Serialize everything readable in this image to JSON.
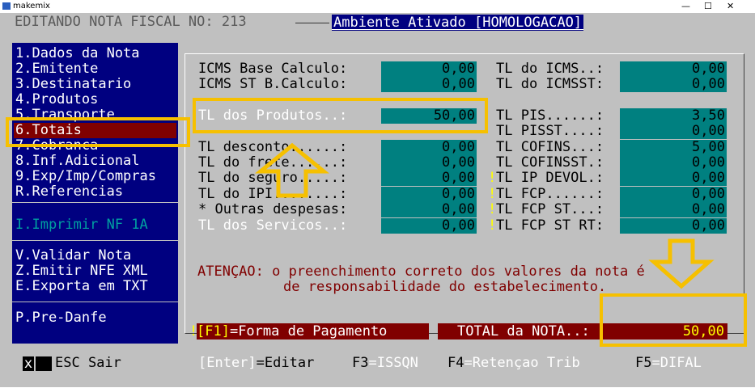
{
  "window": {
    "title": "makemix",
    "minimize": "—",
    "maximize": "☐",
    "close": "✕"
  },
  "header": {
    "title": "EDITANDO NOTA FISCAL NO: 213",
    "ambiente": "Ambiente Ativado [HOMOLOGACAO]"
  },
  "menu": {
    "items": [
      "1.Dados da Nota",
      "2.Emitente",
      "3.Destinatario",
      "4.Produtos",
      "5.Transporte",
      "6.Totais",
      "7.Cobranca",
      "8.Inf.Adicional",
      "9.Exp/Imp/Compras",
      "R.Referencias"
    ],
    "imprimir": "I.Imprimir NF 1A",
    "actions": [
      "V.Validar Nota",
      "Z.Emitir NFE XML",
      "E.Exporta em TXT"
    ],
    "predanfe": "P.Pre-Danfe"
  },
  "left_fields": [
    {
      "label": "ICMS Base Calculo:",
      "value": "0,00"
    },
    {
      "label": "ICMS ST B.Calculo:",
      "value": "0,00"
    },
    {
      "label": "TL dos Produtos..:",
      "value": "50,00"
    },
    {
      "label": "TL desconto......:",
      "value": "0,00"
    },
    {
      "label": "TL do frete......:",
      "value": "0,00"
    },
    {
      "label": "TL do seguro.....:",
      "value": "0,00"
    },
    {
      "label": "TL do IPI........:",
      "value": "0,00"
    },
    {
      "label": "* Outras despesas:",
      "value": "0,00"
    },
    {
      "label": "TL dos Servicos..:",
      "value": "0,00"
    }
  ],
  "right_fields": [
    {
      "label": "TL do ICMS..:",
      "value": "0,00"
    },
    {
      "label": "TL do ICMSST:",
      "value": "0,00"
    },
    {
      "label": "TL PIS......:",
      "value": "3,50"
    },
    {
      "label": "TL PISST....:",
      "value": "0,00"
    },
    {
      "label": "TL COFINS...:",
      "value": "5,00"
    },
    {
      "label": "TL COFINSST.:",
      "value": "0,00"
    },
    {
      "label": "TL IP DEVOL.:",
      "value": "0,00"
    },
    {
      "label": "TL FCP......:",
      "value": "0,00"
    },
    {
      "label": "TL FCP ST...:",
      "value": "0,00"
    },
    {
      "label": "TL FCP ST RT:",
      "value": "0,00"
    }
  ],
  "warning_mark": "!",
  "atencao": {
    "line1": "ATENÇAO: o preenchimento correto dos valores da nota é",
    "line2": "de responsabilidade do estabelecimento."
  },
  "pagamento": {
    "key": "[F1]",
    "label": "=Forma de Pagamento"
  },
  "total": {
    "label": "TOTAL da NOTA..:",
    "value": "50,00"
  },
  "footer": {
    "esc_mark": "x",
    "esc": "ESC Sair",
    "enter_key": "[Enter]",
    "enter_label": "=Editar",
    "f3_key": "F3",
    "f3_label": "=ISSQN",
    "f4_key": "F4",
    "f4_label": "=Retençao Trib",
    "f5_key": "F5",
    "f5_label": "=DIFAL"
  },
  "colors": {
    "menu_bg": "#000080",
    "field_bg": "#008080",
    "highlight": "#800000",
    "annotation": "#f6c000"
  }
}
